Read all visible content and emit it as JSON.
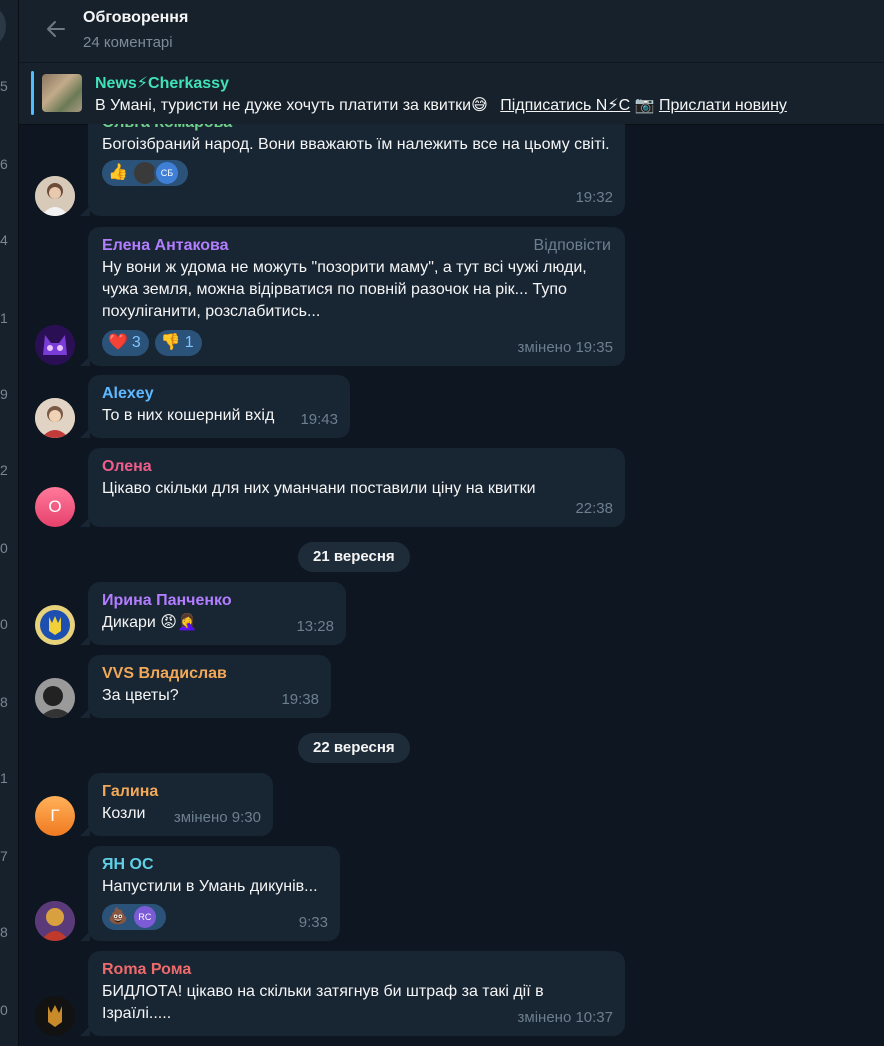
{
  "left_strip": {
    "numbers": [
      "5",
      "6",
      "4",
      "1",
      "9",
      "2",
      "0",
      "0",
      "8",
      "1",
      "7",
      "8",
      "0"
    ]
  },
  "header": {
    "title": "Обговорення",
    "subtitle": "24 коментарі",
    "back_icon": "arrow-left-icon"
  },
  "pinned": {
    "title": "News⚡Cherkassy",
    "text": "В Умані, туристи не дуже  хочуть платити за квитки😅",
    "subscribe_link": "Підписатись N⚡С",
    "camera": "📷",
    "submit_link": "Прислати новину"
  },
  "messages": [
    {
      "author": "Ольга Комарова",
      "name_color": "#6fd18a",
      "text": "Богоізбраний народ. Вони вважають їм належить все на цьому світі.",
      "reactions": [
        {
          "emoji": "👍",
          "count": ""
        }
      ],
      "reaction_avatar": "СБ",
      "time": "19:32"
    },
    {
      "author": "Елена Антакова",
      "name_color": "#b27dff",
      "reply_label": "Відповісти",
      "text": "Ну вони ж удома не можуть \"позорити маму\", а тут всі чужі люди, чужа земля, можна відірватися по повній разочок на рік... Тупо похуліганити, розслабитись...",
      "reactions": [
        {
          "emoji": "❤️",
          "count": "3"
        },
        {
          "emoji": "👎",
          "count": "1"
        }
      ],
      "time": "змінено 19:35"
    },
    {
      "author": "Alexey",
      "name_color": "#5fb9ff",
      "text": "То в них кошерний вхід",
      "time": "19:43"
    },
    {
      "author": "Олена",
      "name_color": "#ef5e8a",
      "avatar_letter": "О",
      "text": "Цікаво скільки для них уманчани поставили ціну на квитки",
      "time": "22:38"
    },
    {
      "author": "Ирина Панченко",
      "name_color": "#b27dff",
      "text": "Дикари 😡🤦‍♀️",
      "time": "13:28"
    },
    {
      "author": "VVS Владислав",
      "name_color": "#f2a957",
      "text": "За цветы?",
      "time": "19:38"
    },
    {
      "author": "Галина",
      "name_color": "#f2a957",
      "avatar_letter": "Г",
      "text": "Козли",
      "time": "змінено 9:30"
    },
    {
      "author": "ЯН ОС",
      "name_color": "#5fd0e6",
      "text": "Напустили в Умань дикунів...",
      "reactions": [
        {
          "emoji": "💩",
          "count": ""
        }
      ],
      "reaction_avatar": "RC",
      "time": "9:33"
    },
    {
      "author": "Roma Рома",
      "name_color": "#ef6b6b",
      "text": "БИДЛОТА! цікаво на скільки затягнув би штраф за такі дії в Ізраїлі.....",
      "time": "змінено 10:37"
    }
  ],
  "dates": [
    "21 вересня",
    "22 вересня"
  ],
  "colors": {
    "bubble": "#182533",
    "background": "#0e1621",
    "accent": "#4fbeff"
  }
}
